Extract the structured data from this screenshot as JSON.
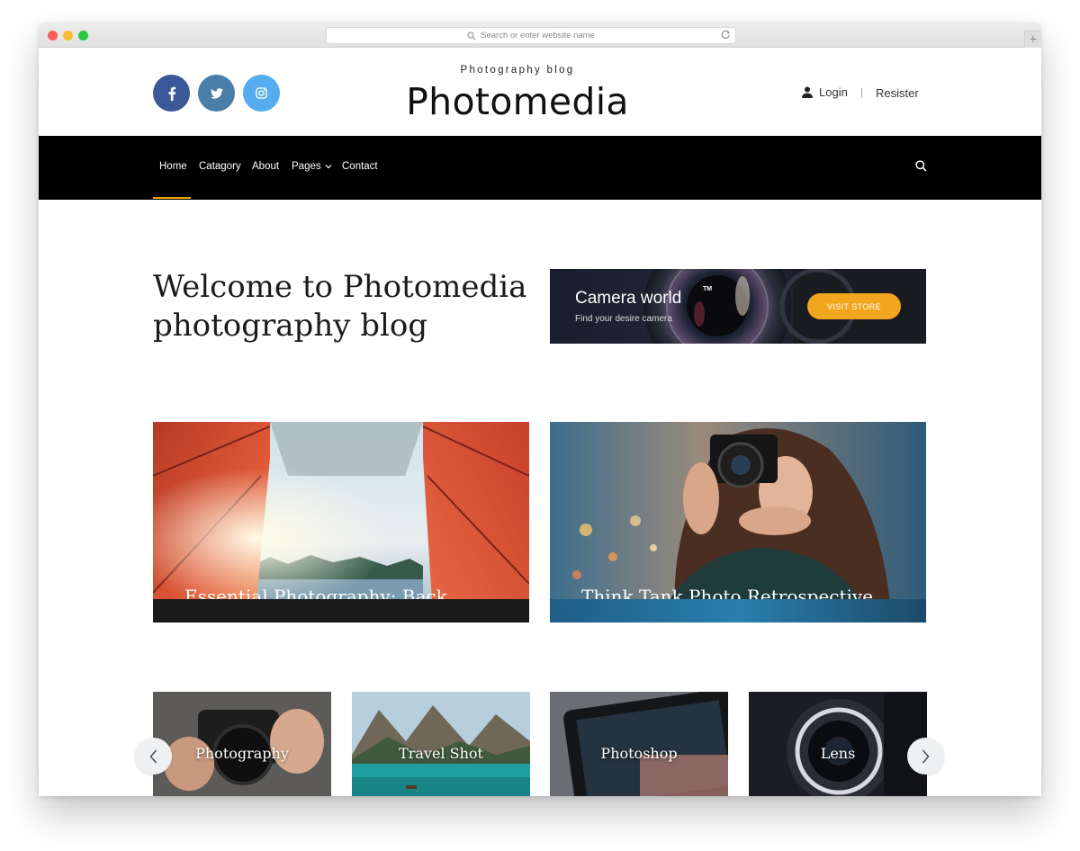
{
  "browser": {
    "url_placeholder": "Search or enter website name",
    "new_tab": "+"
  },
  "header": {
    "tagline": "Photography blog",
    "brand": "Photomedia",
    "login": "Login",
    "separator": "|",
    "register": "Resister",
    "social": [
      {
        "name": "facebook-icon",
        "glyph": "f",
        "color": "#3b5998"
      },
      {
        "name": "twitter-icon",
        "glyph": "twitter",
        "color": "#4a7ea8"
      },
      {
        "name": "instagram-icon",
        "glyph": "instagram",
        "color": "#55acee"
      }
    ]
  },
  "nav": {
    "items": [
      {
        "label": "Home"
      },
      {
        "label": "Catagory"
      },
      {
        "label": "About"
      },
      {
        "label": "Pages"
      },
      {
        "label": "Contact"
      }
    ],
    "accent": "#f0a800"
  },
  "hero": {
    "title_line1": "Welcome to Photomedia",
    "title_line2": "photography blog"
  },
  "banner": {
    "title": "Camera world",
    "trademark": "TM",
    "subtitle": "Find your desire camera",
    "button": "VISIT STORE",
    "button_color": "#f2a61e"
  },
  "features": [
    {
      "caption": "Essential Photography: Back"
    },
    {
      "caption": "Think Tank Photo Retrospective"
    }
  ],
  "categories": [
    {
      "label": "Photography"
    },
    {
      "label": "Travel Shot"
    },
    {
      "label": "Photoshop"
    },
    {
      "label": "Lens"
    }
  ]
}
